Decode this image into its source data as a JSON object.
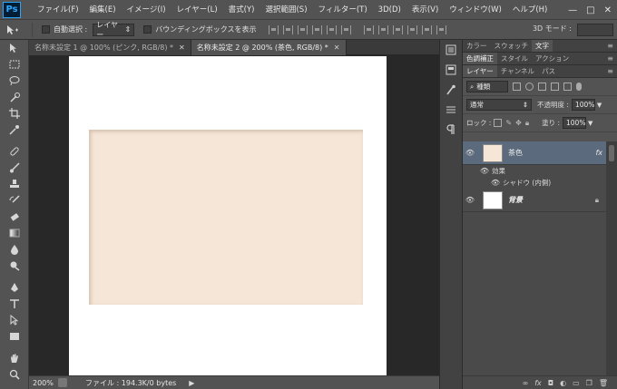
{
  "app": {
    "logo": "Ps"
  },
  "menu": [
    "ファイル(F)",
    "編集(E)",
    "イメージ(I)",
    "レイヤー(L)",
    "書式(Y)",
    "選択範囲(S)",
    "フィルター(T)",
    "3D(D)",
    "表示(V)",
    "ウィンドウ(W)",
    "ヘルプ(H)"
  ],
  "window_controls": {
    "minimize": "—",
    "maximize": "□",
    "close": "✕"
  },
  "options": {
    "auto_select_label": "自動選択 :",
    "auto_select_value": "レイヤー",
    "bounding_box_label": "バウンディングボックスを表示",
    "mode3d_label": "3D モード :"
  },
  "tabs": [
    {
      "label": "名称未設定 1 @ 100% (ピンク, RGB/8) *",
      "close": "✕",
      "active": false
    },
    {
      "label": "名称未設定 2 @ 200% (茶色, RGB/8) *",
      "close": "✕",
      "active": true
    }
  ],
  "canvas": {
    "page_color": "#ffffff",
    "rect_color": "#f5e6d8"
  },
  "status": {
    "zoom": "200%",
    "file_info": "ファイル : 194.3K/0 bytes",
    "arrow": "▶"
  },
  "panels": {
    "group1_tabs": [
      "カラー",
      "スウォッチ",
      "文字"
    ],
    "group2_tabs": [
      "色調補正",
      "スタイル",
      "アクション"
    ],
    "group3_tabs": [
      "レイヤー",
      "チャンネル",
      "パス"
    ],
    "filter_kind": "種類",
    "blend_mode": "通常",
    "opacity_label": "不透明度 :",
    "opacity_value": "100%",
    "lock_label": "ロック :",
    "fill_label": "塗り :",
    "fill_value": "100%"
  },
  "layers": [
    {
      "name": "茶色",
      "fx": "fx",
      "selected": true,
      "effects_label": "効果",
      "effect": "シャドウ (内側)"
    },
    {
      "name": "背景",
      "locked": true
    }
  ],
  "colors": {
    "selected_layer": "#5b6a7c",
    "accent": "#31a8ff"
  }
}
